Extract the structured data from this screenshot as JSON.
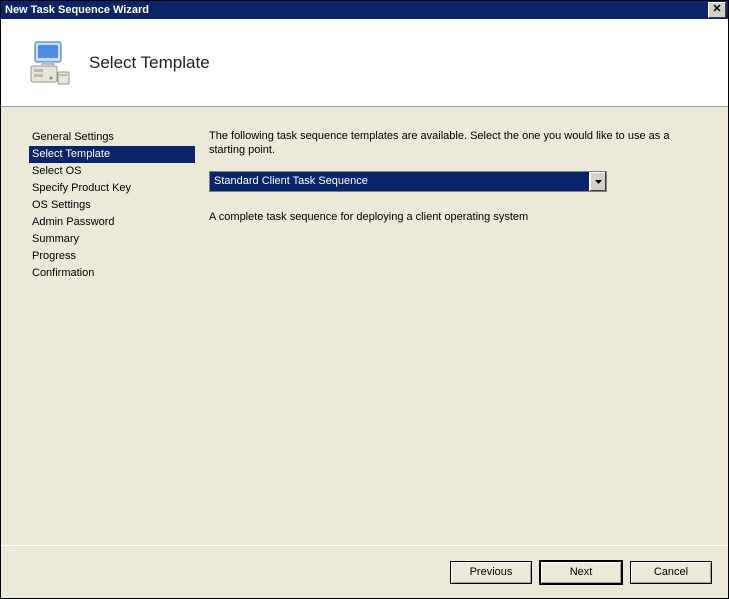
{
  "window": {
    "title": "New Task Sequence Wizard"
  },
  "header": {
    "heading": "Select Template"
  },
  "sidebar": {
    "items": [
      {
        "label": "General Settings",
        "selected": false
      },
      {
        "label": "Select Template",
        "selected": true
      },
      {
        "label": "Select OS",
        "selected": false
      },
      {
        "label": "Specify Product Key",
        "selected": false
      },
      {
        "label": "OS Settings",
        "selected": false
      },
      {
        "label": "Admin Password",
        "selected": false
      },
      {
        "label": "Summary",
        "selected": false
      },
      {
        "label": "Progress",
        "selected": false
      },
      {
        "label": "Confirmation",
        "selected": false
      }
    ]
  },
  "main": {
    "instruction": "The following task sequence templates are available.  Select the one you would like to use as a starting point.",
    "dropdown": {
      "value": "Standard Client Task Sequence"
    },
    "description": "A complete task sequence for deploying a client operating system"
  },
  "footer": {
    "previous": "Previous",
    "next": "Next",
    "cancel": "Cancel"
  }
}
